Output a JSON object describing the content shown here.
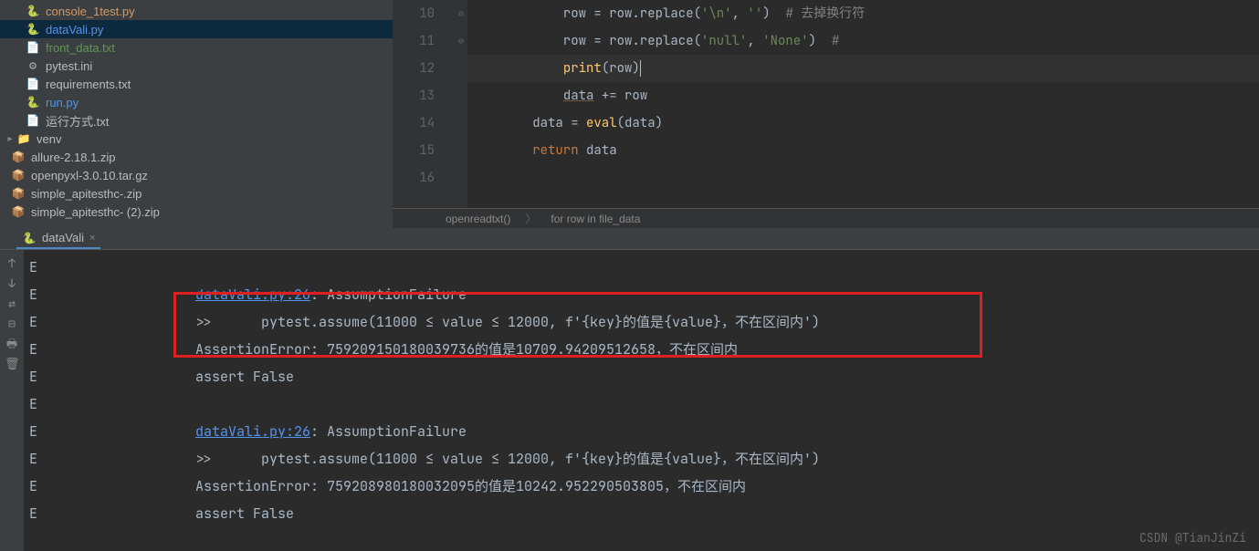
{
  "sidebar": {
    "files": [
      {
        "name": "console_1test.py",
        "icon": "py",
        "colorClass": "orange",
        "indent": 28
      },
      {
        "name": "dataVali.py",
        "icon": "py",
        "colorClass": "blue",
        "indent": 28,
        "selected": true
      },
      {
        "name": "front_data.txt",
        "icon": "txt",
        "colorClass": "green",
        "indent": 28
      },
      {
        "name": "pytest.ini",
        "icon": "ini",
        "colorClass": "",
        "indent": 28
      },
      {
        "name": "requirements.txt",
        "icon": "txt",
        "colorClass": "",
        "indent": 28
      },
      {
        "name": "run.py",
        "icon": "py",
        "colorClass": "blue",
        "indent": 28
      },
      {
        "name": "运行方式.txt",
        "icon": "txt",
        "colorClass": "",
        "indent": 28
      },
      {
        "name": "venv",
        "icon": "folder",
        "colorClass": "",
        "indent": 4,
        "arrow": "▸"
      },
      {
        "name": "allure-2.18.1.zip",
        "icon": "zip",
        "colorClass": "",
        "indent": 12
      },
      {
        "name": "openpyxl-3.0.10.tar.gz",
        "icon": "zip",
        "colorClass": "",
        "indent": 12
      },
      {
        "name": "simple_apitesthc-.zip",
        "icon": "zip",
        "colorClass": "",
        "indent": 12
      },
      {
        "name": "simple_apitesthc- (2).zip",
        "icon": "zip",
        "colorClass": "",
        "indent": 12
      }
    ]
  },
  "editor": {
    "lines": [
      {
        "num": "10",
        "html": "            row = row.replace(<span class='str'>'\\n'</span><span class='var'>, </span><span class='str'>''</span>)  <span class='cmt'># 去掉换行符</span>"
      },
      {
        "num": "11",
        "html": "            row = row.replace(<span class='str'>'null'</span><span class='var'>, </span><span class='str'>'None'</span>)  <span class='cmt'>#</span>"
      },
      {
        "num": "12",
        "html": "            <span class='fn'>print</span>(row)<span class='caret'></span>",
        "current": true
      },
      {
        "num": "13",
        "html": "            <span class='underline'>data</span> += row",
        "fold": "⊖"
      },
      {
        "num": "14",
        "html": "        data = <span class='fn'>eval</span>(data)"
      },
      {
        "num": "15",
        "html": "        <span class='kw'>return </span>data",
        "fold": "⊖"
      },
      {
        "num": "16",
        "html": ""
      }
    ],
    "breadcrumb": {
      "fn": "openreadtxt()",
      "loop": "for row in file_data"
    }
  },
  "tab": {
    "name": "dataVali"
  },
  "console": {
    "lines": [
      {
        "e": "E",
        "msg": ""
      },
      {
        "e": "E",
        "msg": "<span class='link'>dataVali.py:26</span>: AssumptionFailure"
      },
      {
        "e": "E",
        "msg": ">>\tpytest.assume(11000 ≤ value ≤ 12000, f'{key}的值是{value}，不在区间内')"
      },
      {
        "e": "E",
        "msg": "AssertionError: 759209150180039736的值是10709.94209512658，不在区间内"
      },
      {
        "e": "E",
        "msg": "assert False"
      },
      {
        "e": "E",
        "msg": ""
      },
      {
        "e": "E",
        "msg": "<span class='link'>dataVali.py:26</span>: AssumptionFailure"
      },
      {
        "e": "E",
        "msg": ">>\tpytest.assume(11000 ≤ value ≤ 12000, f'{key}的值是{value}，不在区间内')"
      },
      {
        "e": "E",
        "msg": "AssertionError: 759208980180032095的值是10242.952290503805，不在区间内"
      },
      {
        "e": "E",
        "msg": "assert False"
      }
    ]
  },
  "watermark": "CSDN @TianJinZi"
}
